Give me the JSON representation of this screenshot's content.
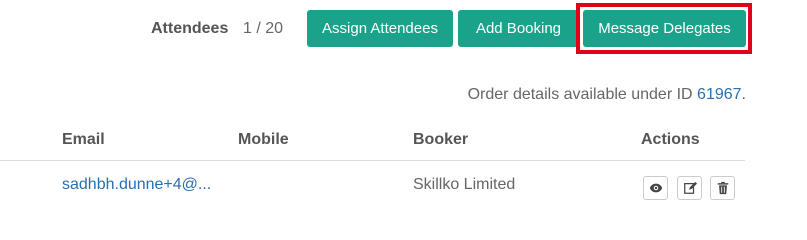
{
  "toolbar": {
    "attendees_label": "Attendees",
    "attendees_count": "1 / 20",
    "assign_label": "Assign Attendees",
    "add_booking_label": "Add Booking",
    "message_delegates_label": "Message Delegates"
  },
  "order": {
    "prefix": "Order details available under ID ",
    "id": "61967",
    "suffix": "."
  },
  "table": {
    "headers": {
      "email": "Email",
      "mobile": "Mobile",
      "booker": "Booker",
      "actions": "Actions"
    },
    "rows": [
      {
        "email": "sadhbh.dunne+4@...",
        "mobile": "",
        "booker": "Skillko Limited"
      }
    ]
  },
  "colors": {
    "primary": "#1aa38a",
    "link": "#2a6fb0",
    "highlight": "#e0001b"
  },
  "icons": {
    "view": "eye-icon",
    "edit": "edit-icon",
    "delete": "trash-icon"
  }
}
